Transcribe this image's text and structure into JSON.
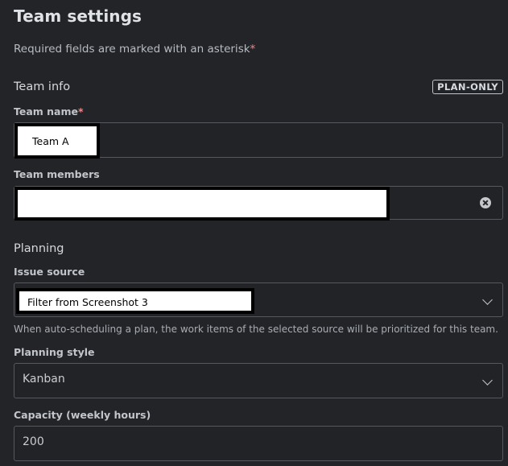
{
  "page": {
    "title": "Team settings",
    "required_note": "Required fields are marked with an asterisk",
    "asterisk": "*"
  },
  "team_info": {
    "heading": "Team info",
    "badge": "PLAN-ONLY",
    "team_name": {
      "label": "Team name",
      "value": "Team A"
    },
    "team_members": {
      "label": "Team members",
      "value": ""
    }
  },
  "planning": {
    "heading": "Planning",
    "issue_source": {
      "label": "Issue source",
      "value": "Filter from Screenshot 3",
      "help": "When auto-scheduling a plan, the work items of the selected source will be prioritized for this team."
    },
    "planning_style": {
      "label": "Planning style",
      "value": "Kanban"
    },
    "capacity": {
      "label": "Capacity (weekly hours)",
      "value": "200"
    }
  },
  "icons": {
    "clear": "clear-icon",
    "dropdown": "chevron-down-icon"
  },
  "colors": {
    "background": "#232427",
    "asterisk": "#f0868a",
    "field_border": "#55585e"
  }
}
